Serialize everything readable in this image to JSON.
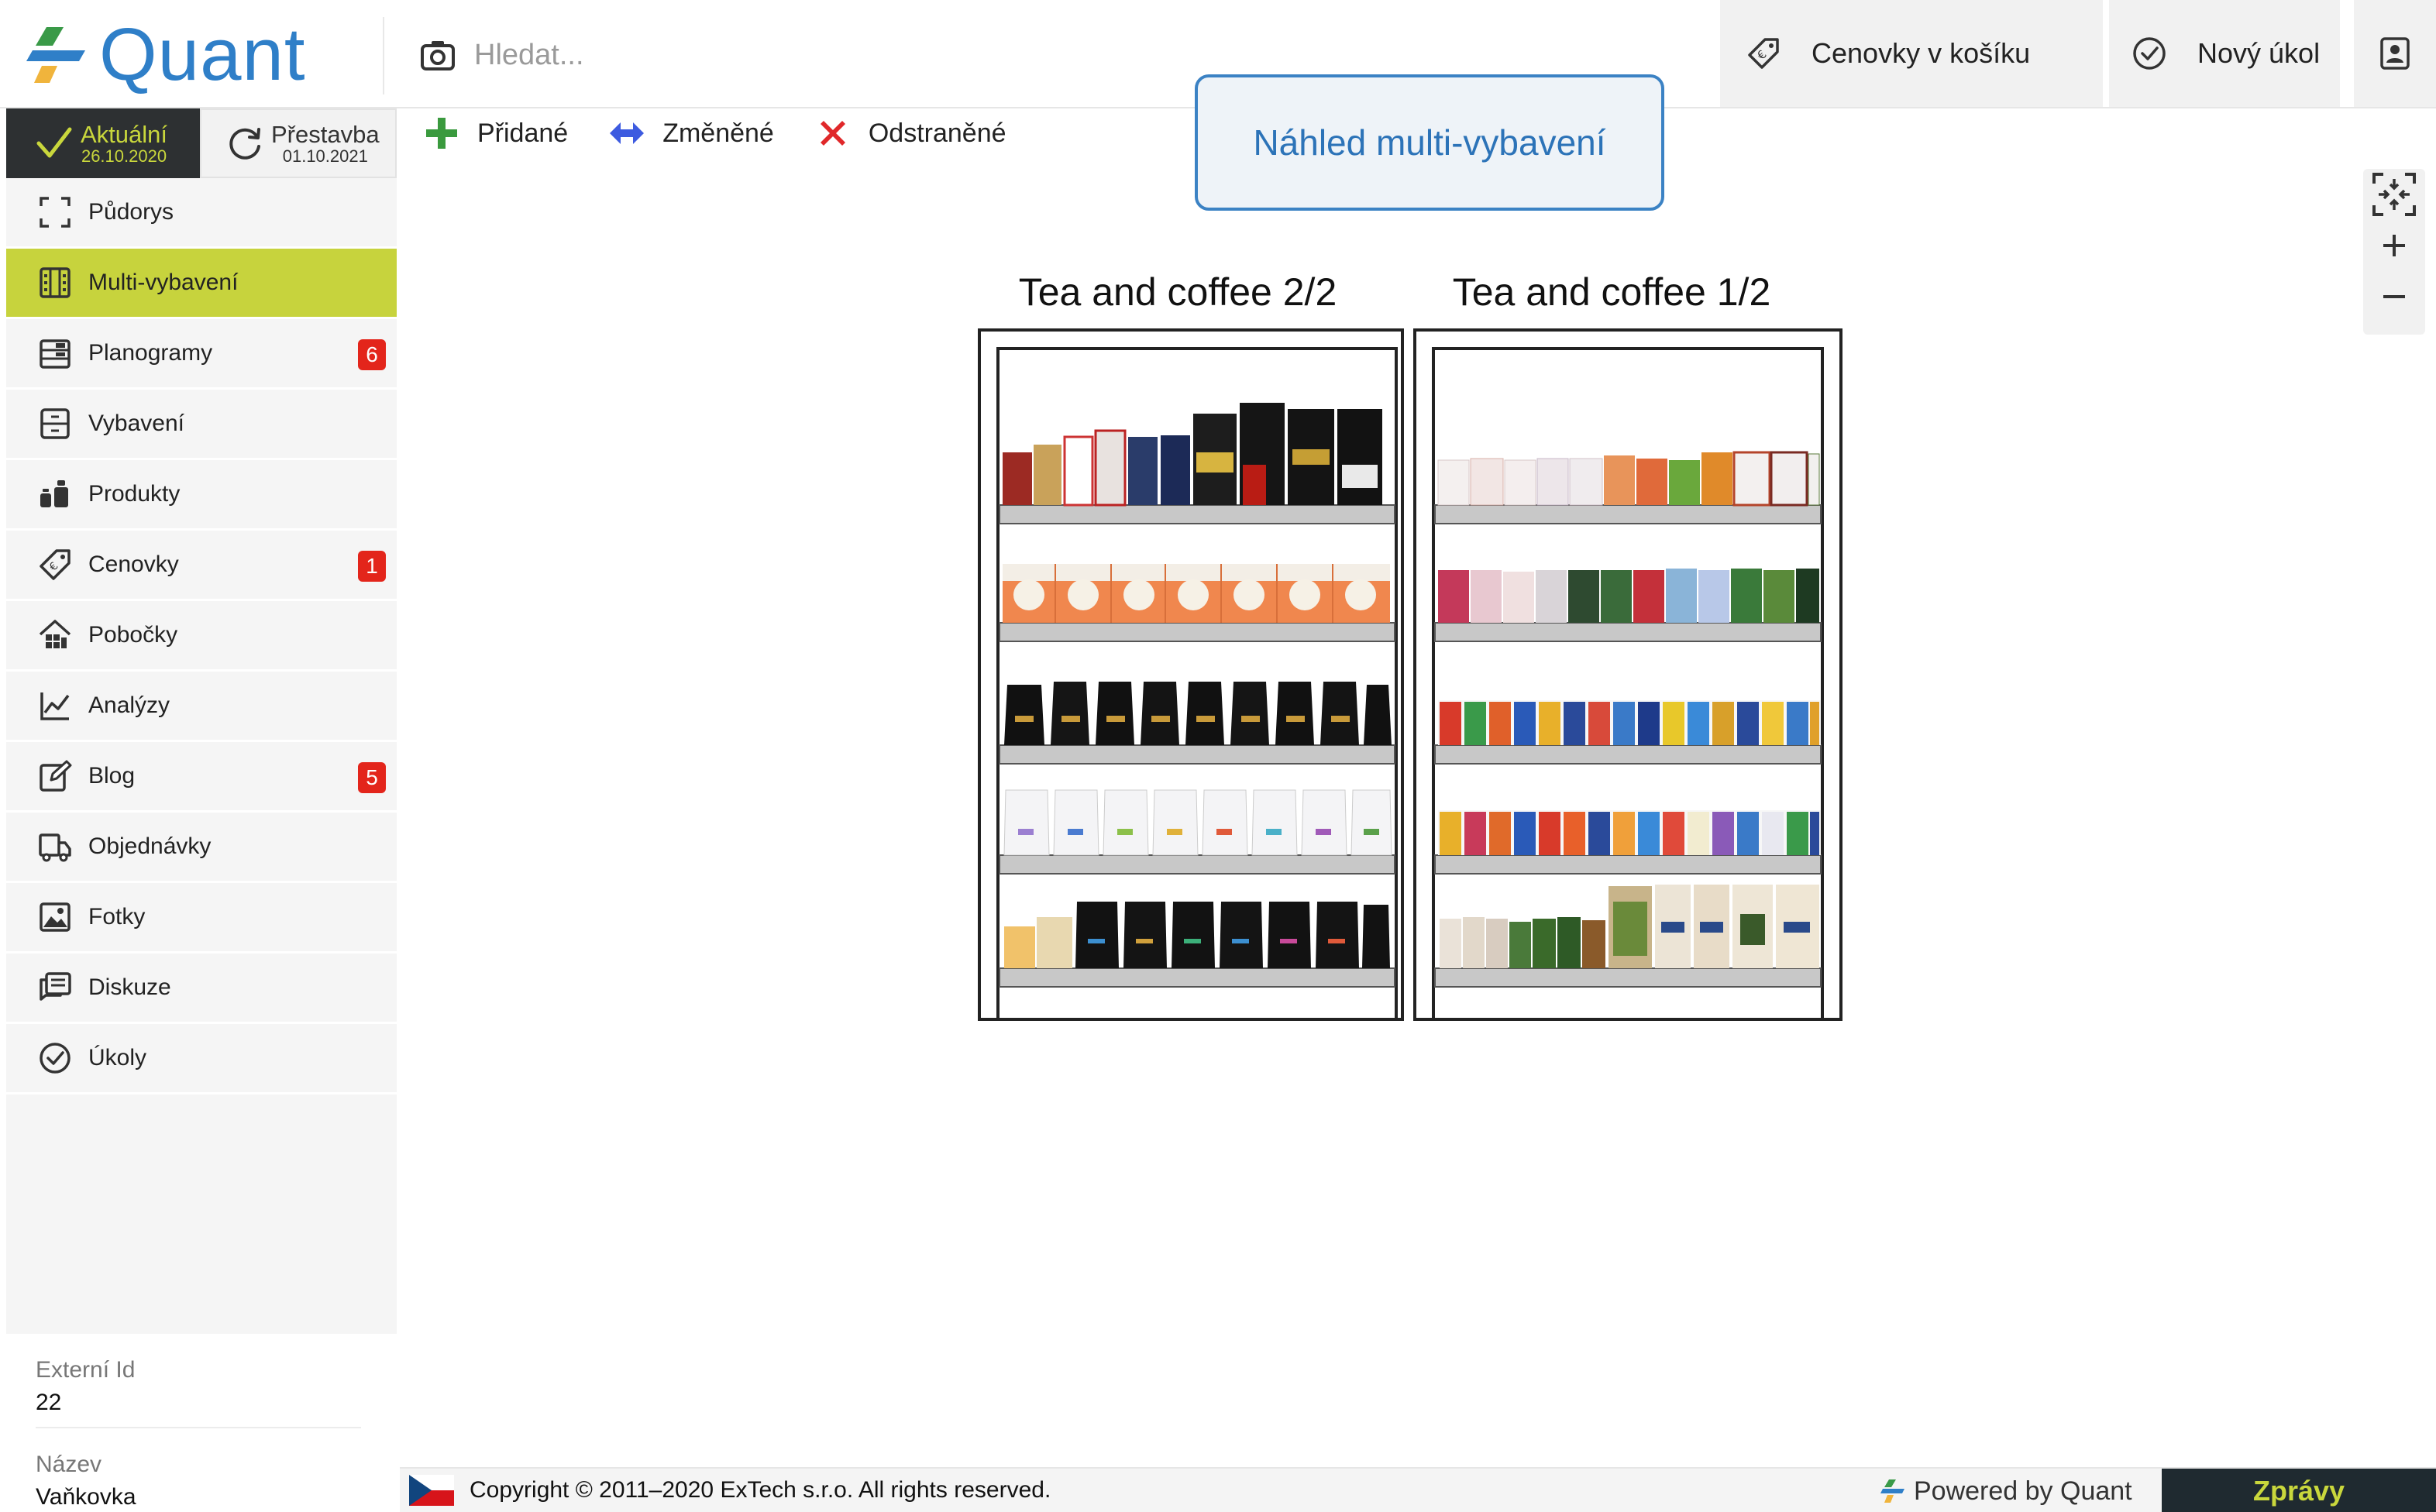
{
  "app": {
    "name": "Quant"
  },
  "search": {
    "placeholder": "Hledat..."
  },
  "header": {
    "cart_label": "Cenovky v košíku",
    "task_label": "Nový úkol",
    "user_icon": "user-badge-icon"
  },
  "versions": {
    "current": {
      "label": "Aktuální",
      "date": "26.10.2020"
    },
    "rebuild": {
      "label": "Přestavba",
      "date": "01.10.2021"
    }
  },
  "sidebar": {
    "items": [
      {
        "label": "Půdorys",
        "icon": "floorplan-icon",
        "active": false,
        "badge": ""
      },
      {
        "label": "Multi-vybavení",
        "icon": "grid-icon",
        "active": true,
        "badge": ""
      },
      {
        "label": "Planogramy",
        "icon": "planogram-icon",
        "active": false,
        "badge": "6"
      },
      {
        "label": "Vybavení",
        "icon": "cabinet-icon",
        "active": false,
        "badge": ""
      },
      {
        "label": "Produkty",
        "icon": "products-icon",
        "active": false,
        "badge": ""
      },
      {
        "label": "Cenovky",
        "icon": "price-tag-icon",
        "active": false,
        "badge": "1"
      },
      {
        "label": "Pobočky",
        "icon": "store-icon",
        "active": false,
        "badge": ""
      },
      {
        "label": "Analýzy",
        "icon": "analytics-icon",
        "active": false,
        "badge": ""
      },
      {
        "label": "Blog",
        "icon": "edit-icon",
        "active": false,
        "badge": "5"
      },
      {
        "label": "Objednávky",
        "icon": "delivery-truck-icon",
        "active": false,
        "badge": ""
      },
      {
        "label": "Fotky",
        "icon": "photo-icon",
        "active": false,
        "badge": ""
      },
      {
        "label": "Diskuze",
        "icon": "discussion-icon",
        "active": false,
        "badge": ""
      },
      {
        "label": "Úkoly",
        "icon": "check-circle-icon",
        "active": false,
        "badge": ""
      }
    ]
  },
  "store_info": {
    "external_id_label": "Externí Id",
    "external_id_value": "22",
    "name_label": "Název",
    "name_value": "Vaňkovka"
  },
  "legend": {
    "added": "Přidané",
    "changed": "Změněné",
    "removed": "Odstraněné"
  },
  "preview": {
    "title": "Náhled multi-vybavení"
  },
  "units": [
    {
      "title": "Tea and coffee 2/2"
    },
    {
      "title": "Tea and coffee 1/2"
    }
  ],
  "footer": {
    "copyright": "Copyright © 2011–2020 ExTech s.r.o. All rights reserved.",
    "powered": "Powered by Quant",
    "news": "Zprávy"
  },
  "colors": {
    "brand_blue": "#2f7fc8",
    "active_nav": "#c7d33d",
    "badge_red": "#e3251b",
    "dark": "#2d3032"
  }
}
